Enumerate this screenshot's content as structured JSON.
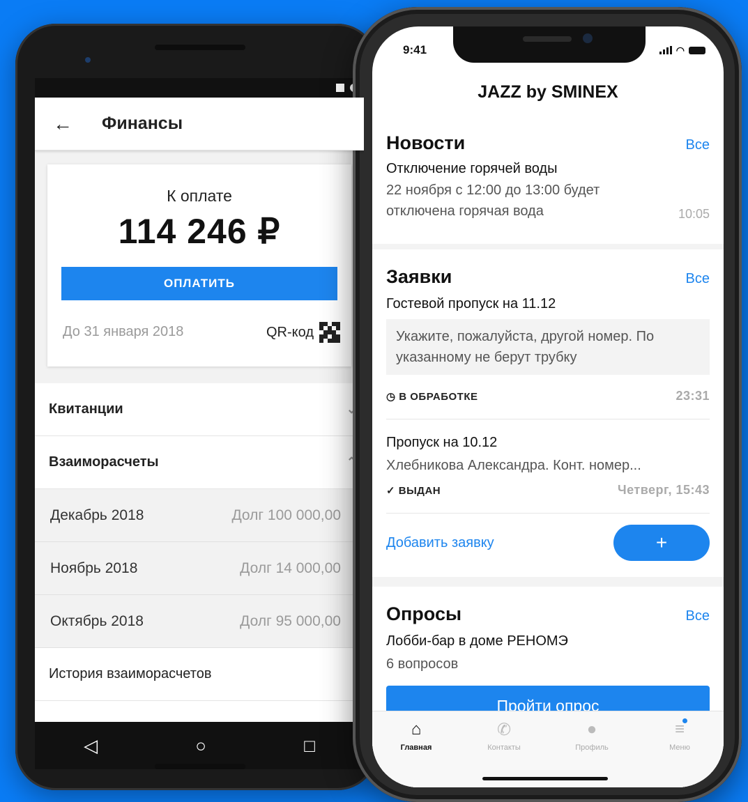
{
  "android": {
    "header_title": "Финансы",
    "pay_label": "К оплате",
    "amount": "114 246 ₽",
    "pay_button": "ОПЛАТИТЬ",
    "due_date": "До 31 января 2018",
    "qr_label": "QR-код",
    "receipts": "Квитанции",
    "settlements": "Взаиморасчеты",
    "months": [
      {
        "month": "Декабрь 2018",
        "debt": "Долг  100 000,00"
      },
      {
        "month": "Ноябрь 2018",
        "debt": "Долг  14 000,00"
      },
      {
        "month": "Октябрь 2018",
        "debt": "Долг 95 000,00"
      }
    ],
    "history": "История взаиморасчетов"
  },
  "iphone": {
    "time": "9:41",
    "app_title": "JAZZ by SMINEX",
    "news": {
      "title": "Новости",
      "all": "Все",
      "headline": "Отключение горячей воды",
      "body": "22 ноября с 12:00 до 13:00 будет отключена горячая вода",
      "time": "10:05"
    },
    "requests": {
      "title": "Заявки",
      "all": "Все",
      "item1_title": "Гостевой пропуск на 11.12",
      "item1_comment": "Укажите, пожалуйста, другой номер. По указанному не берут трубку",
      "item1_status": "В ОБРАБОТКЕ",
      "item1_time": "23:31",
      "item2_title": "Пропуск на 10.12",
      "item2_desc": "Хлебникова Александра. Конт. номер...",
      "item2_status": "ВЫДАН",
      "item2_time": "Четверг, 15:43",
      "add_link": "Добавить заявку",
      "add_button": "+"
    },
    "surveys": {
      "title": "Опросы",
      "all": "Все",
      "item_title": "Лобби-бар в доме РЕНОМЭ",
      "item_count": "6 вопросов",
      "button": "Пройти опрос"
    },
    "tabs": [
      "Главная",
      "Контакты",
      "Профиль",
      "Меню"
    ]
  },
  "colors": {
    "accent": "#1d85ee",
    "background": "#0a7cf5"
  }
}
